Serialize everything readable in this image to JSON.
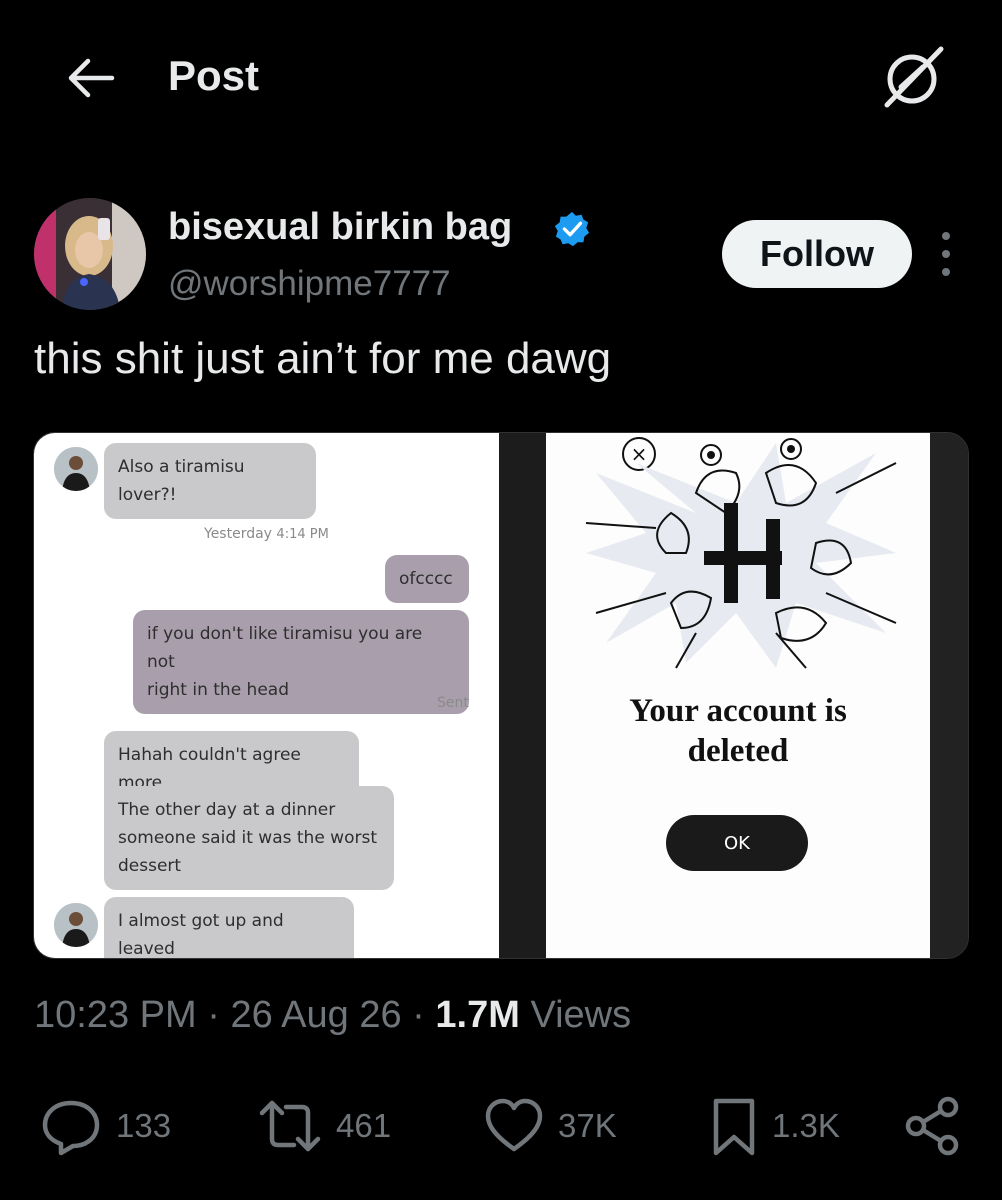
{
  "header": {
    "title": "Post",
    "back_icon": "arrow-left-icon",
    "grok_icon": "grok-icon"
  },
  "author": {
    "name": "bisexual birkin bag",
    "handle": "@worshipme7777",
    "verified": true,
    "follow_label": "Follow"
  },
  "post": {
    "text": "this shit just ain’t for me dawg"
  },
  "media": {
    "chat": {
      "messages": [
        {
          "from": "them",
          "text": "Also a tiramisu lover?!"
        },
        {
          "from": "me",
          "text": "ofcccc"
        },
        {
          "from": "me",
          "text_line1": "if you don't like tiramisu you are not",
          "text_line2": "right in the head"
        },
        {
          "from": "them",
          "text": "Hahah couldn't agree more"
        },
        {
          "from": "them",
          "text_line1": "The other day at a dinner",
          "text_line2": "someone said it was the worst",
          "text_line3": "dessert"
        },
        {
          "from": "them",
          "text": "I almost got up and leaved"
        }
      ],
      "timestamp_day": "Yesterday",
      "timestamp_time": "4:14 PM",
      "sent_label": "Sent"
    },
    "modal": {
      "title_line1": "Your account is",
      "title_line2": "deleted",
      "ok_label": "OK",
      "close_glyph": "×"
    }
  },
  "meta": {
    "time": "10:23 PM",
    "date": "26 Aug 26",
    "views_count": "1.7M",
    "views_label": "Views",
    "separator": "·"
  },
  "actions": {
    "replies": "133",
    "reposts": "461",
    "likes": "37K",
    "bookmarks": "1.3K"
  },
  "colors": {
    "background": "#000000",
    "text_primary": "#e7e9ea",
    "text_secondary": "#71767b",
    "verified_blue": "#1d9bf0",
    "follow_bg": "#eff3f4"
  }
}
